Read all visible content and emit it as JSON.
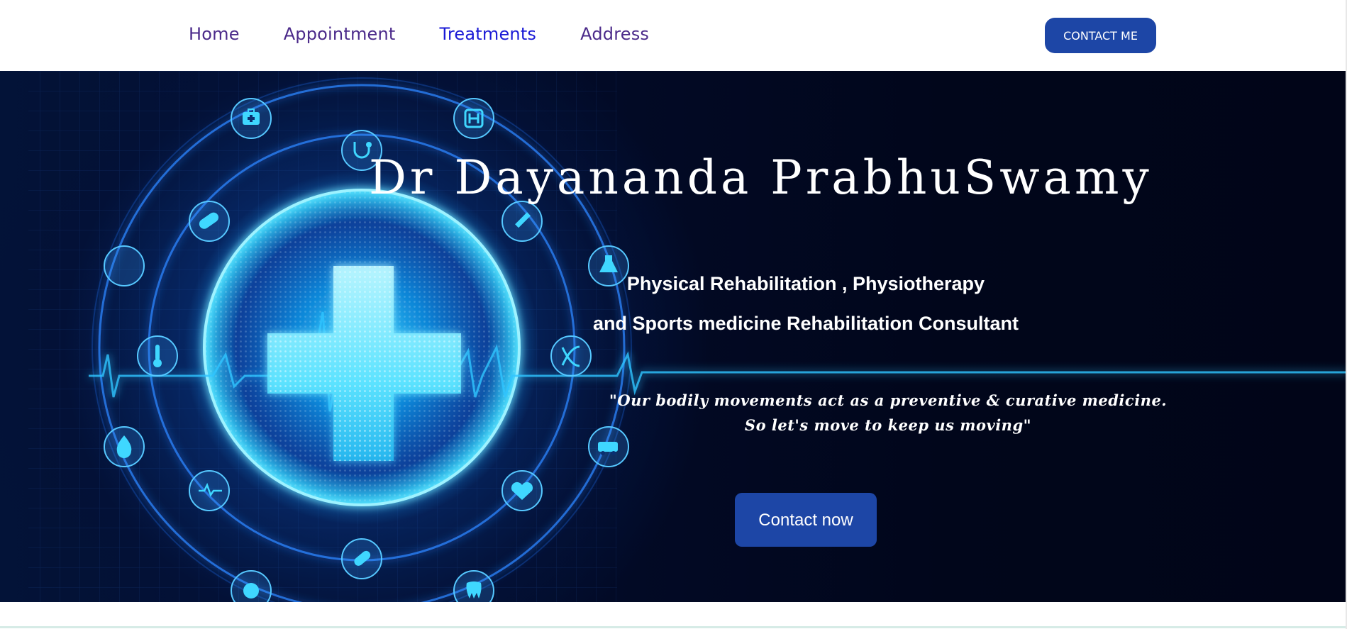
{
  "nav": {
    "items": [
      {
        "label": "Home"
      },
      {
        "label": "Appointment"
      },
      {
        "label": "Treatments"
      },
      {
        "label": "Address"
      }
    ],
    "contact_label": "CONTACT ME"
  },
  "hero": {
    "title": "Dr Dayananda PrabhuSwamy",
    "subtitle_line1": "Physical Rehabilitation , Physiotherapy",
    "subtitle_line2": "and Sports medicine Rehabilitation Consultant",
    "quote_line1": "\"Our bodily movements act as a preventive & curative medicine.",
    "quote_line2": "So let's move to keep us moving\"",
    "cta_label": "Contact now",
    "icons": [
      "medical-kit-icon",
      "hospital-icon",
      "stethoscope-icon",
      "bandage-icon",
      "syringe-icon",
      "pill-capsule-icon",
      "flask-icon",
      "thermometer-icon",
      "dna-icon",
      "blood-drop-icon",
      "ambulance-icon",
      "heartbeat-icon",
      "heart-monitor-icon",
      "capsule-icon",
      "tooth-icon",
      "brain-icon"
    ]
  },
  "colors": {
    "nav_text": "#4b2a8a",
    "nav_active": "#1a1ad6",
    "button_bg": "#1d46a6",
    "hero_bg": "#020a26",
    "glow": "#25c9f5"
  }
}
